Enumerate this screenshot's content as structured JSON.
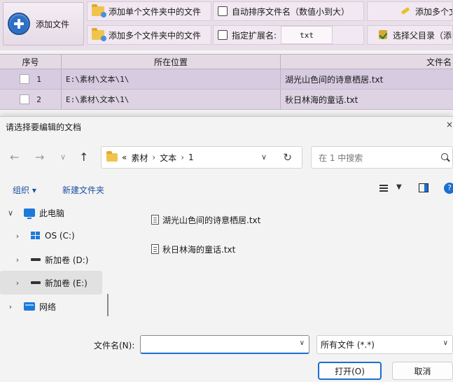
{
  "toolbar": {
    "add_file": "添加文件",
    "add_single_folder": "添加单个文件夹中的文件",
    "add_multi_folder": "添加多个文件夹中的文件",
    "auto_sort": "自动排序文件名（数值小到大）",
    "specify_ext": "指定扩展名:",
    "ext_value": "txt",
    "add_multi_partial": "添加多个文",
    "select_parent_partial": "选择父目录（添"
  },
  "grid": {
    "headers": {
      "no": "序号",
      "location": "所在位置",
      "name": "文件名"
    },
    "rows": [
      {
        "no": "1",
        "location": "E:\\素材\\文本\\1\\",
        "name": "湖光山色间的诗意栖居.txt"
      },
      {
        "no": "2",
        "location": "E:\\素材\\文本\\1\\",
        "name": "秋日林海的童话.txt"
      }
    ]
  },
  "dialog": {
    "title": "请选择要编辑的文档",
    "close": "×",
    "nav": {
      "back": "←",
      "forward": "→",
      "recent": "∨",
      "up": "↑"
    },
    "address": {
      "overflow": "«",
      "segments": [
        "素材",
        "文本",
        "1"
      ],
      "sep": "›"
    },
    "search_placeholder": "在 1 中搜索",
    "commands": {
      "organize": "组织 ▾",
      "new_folder": "新建文件夹"
    },
    "tree": [
      {
        "chev": "∨",
        "icon": "pc-icon",
        "label": "此电脑"
      },
      {
        "chev": "›",
        "icon": "os-drive-icon",
        "label": "OS (C:)"
      },
      {
        "chev": "›",
        "icon": "drive-icon",
        "label": "新加卷 (D:)"
      },
      {
        "chev": "›",
        "icon": "drive-icon",
        "label": "新加卷 (E:)"
      },
      {
        "chev": "›",
        "icon": "network-icon",
        "label": "网络"
      }
    ],
    "files": [
      {
        "name": "湖光山色间的诗意栖居.txt"
      },
      {
        "name": "秋日林海的童话.txt"
      }
    ],
    "filename_label": "文件名(N):",
    "filename_value": "",
    "filetype": "所有文件 (*.*)",
    "open": "打开(O)",
    "cancel": "取消"
  },
  "colors": {
    "accent": "#1a6fd0",
    "toolbar_bg": "#e9dfe9",
    "grid_row": "#ddd3e3"
  }
}
